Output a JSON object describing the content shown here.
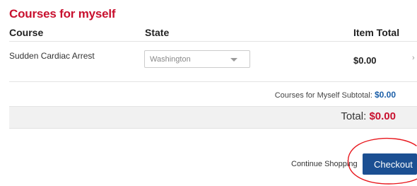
{
  "section": {
    "title": "Courses for myself"
  },
  "table": {
    "columns": [
      "Course",
      "State",
      "Item Total"
    ],
    "rows": [
      {
        "course": "Sudden Cardiac Arrest",
        "state": "Washington",
        "item_total": "$0.00",
        "chevron": "›"
      }
    ]
  },
  "summary": {
    "subtotal_label": "Courses for Myself Subtotal:",
    "subtotal_value": "$0.00",
    "total_label": "Total:",
    "total_value": "$0.00"
  },
  "actions": {
    "continue_label": "Continue Shopping",
    "checkout_label": "Checkout"
  },
  "colors": {
    "brand_red": "#c8102e",
    "brand_blue": "#1b4f92",
    "link_blue": "#1b5fa8",
    "annotation_red": "#e8161c"
  },
  "icons": [
    "chevron-down-icon",
    "chevron-right-icon"
  ]
}
